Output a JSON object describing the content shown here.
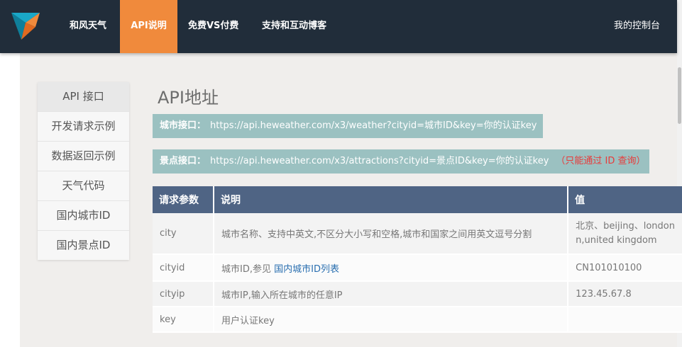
{
  "header": {
    "nav": [
      "和风天气",
      "API说明",
      "免费VS付费",
      "支持和互动博客"
    ],
    "active_index": 1,
    "right_link": "我的控制台"
  },
  "sidebar": {
    "items": [
      "API 接口",
      "开发请求示例",
      "数据返回示例",
      "天气代码",
      "国内城市ID",
      "国内景点ID"
    ],
    "active_index": 0
  },
  "main": {
    "title": "API地址",
    "city_api": {
      "label": "城市接口：",
      "url": "https://api.heweather.com/x3/weather?cityid=城市ID&key=你的认证key"
    },
    "attraction_api": {
      "label": "景点接口：",
      "url": "https://api.heweather.com/x3/attractions?cityid=景点ID&key=你的认证key",
      "note": "（只能通过 ID 查询）"
    },
    "table": {
      "headers": [
        "请求参数",
        "说明",
        "值"
      ],
      "rows": [
        {
          "param": "city",
          "desc": "城市名称、支持中英文,不区分大小写和空格,城市和国家之间用英文逗号分割",
          "value_lines": [
            "北京、beijing、london",
            "n,united kingdom"
          ]
        },
        {
          "param": "cityid",
          "desc": "城市ID,参见",
          "link": "国内城市ID列表",
          "value_lines": [
            "CN101010100"
          ]
        },
        {
          "param": "cityip",
          "desc": "城市IP,输入所在城市的任意IP",
          "value_lines": [
            "123.45.67.8"
          ]
        },
        {
          "param": "key",
          "desc": "用户认证key",
          "value_lines": [
            ""
          ]
        }
      ]
    }
  },
  "colors": {
    "topbar": "#212d3a",
    "active_nav": "#f08a3c",
    "url_box": "#9bc1c1",
    "table_header": "#4f6484",
    "link": "#2a6fb0",
    "note_red": "#e83a3a"
  },
  "icons": {
    "logo": "heweather-logo"
  }
}
